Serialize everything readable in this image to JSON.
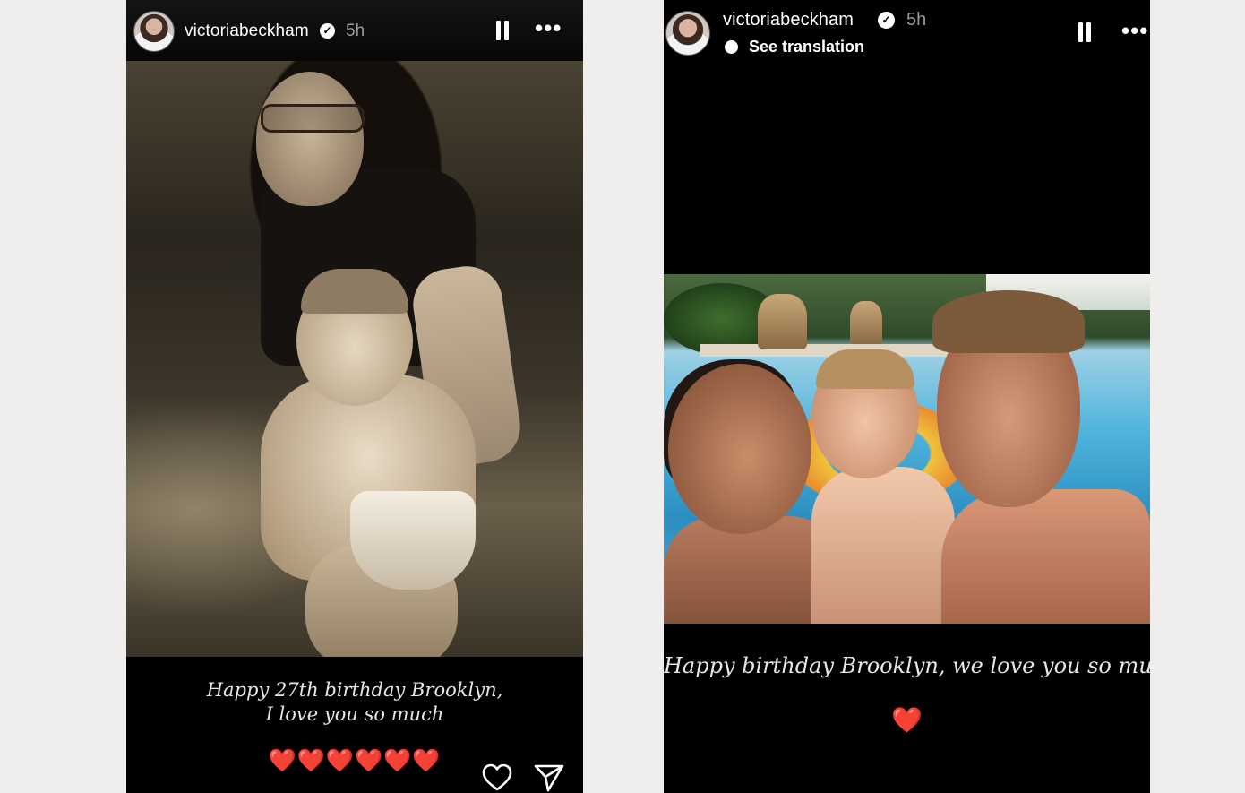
{
  "left_story": {
    "username": "victoriabeckham",
    "time": "5h",
    "caption_line1": "Happy 27th birthday Brooklyn,",
    "caption_line2": "I love you so much",
    "hearts": "❤️❤️❤️❤️❤️❤️"
  },
  "right_story": {
    "username": "victoriabeckham",
    "time": "5h",
    "see_translation": "See translation",
    "caption": "Happy birthday Brooklyn, we love you so much",
    "heart": "❤️"
  },
  "icons": {
    "verified": "verified-badge-icon",
    "pause": "pause-icon",
    "more": "more-options-icon",
    "like": "heart-outline-icon",
    "send": "paper-plane-icon",
    "translation": "translation-dot-icon"
  },
  "colors": {
    "background": "#efeeec",
    "story_bg": "#000000",
    "heart_red": "#c62828"
  }
}
